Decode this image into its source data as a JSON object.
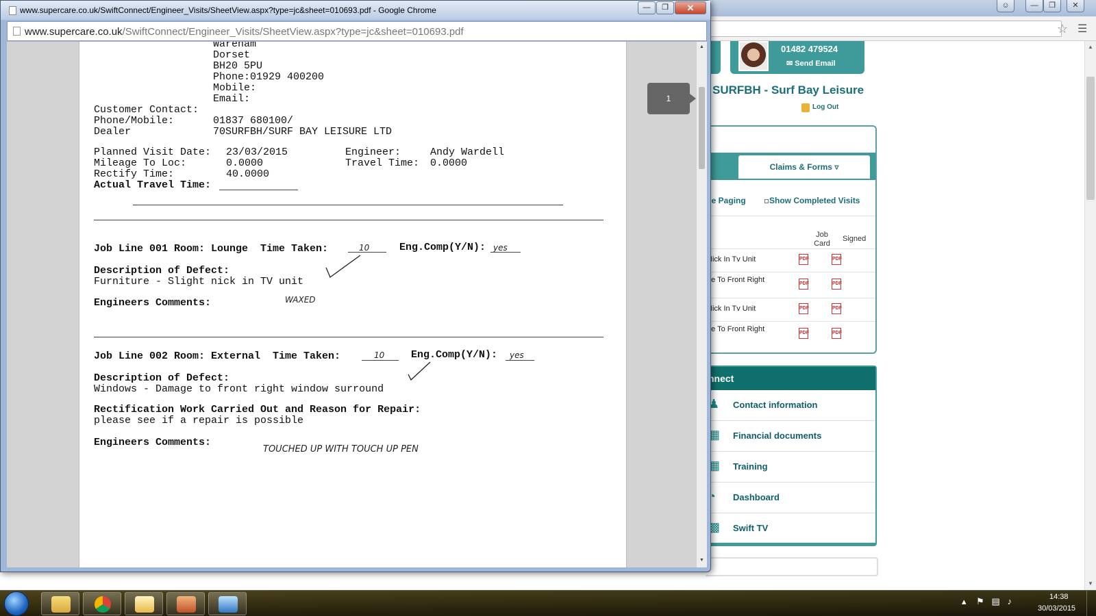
{
  "popup": {
    "title": "www.supercare.co.uk/SwiftConnect/Engineer_Visits/SheetView.aspx?type=jc&sheet=010693.pdf - Google Chrome",
    "url_host": "www.supercare.co.uk",
    "url_path": "/SwiftConnect/Engineer_Visits/SheetView.aspx?type=jc&sheet=010693.pdf",
    "page_badge": "1"
  },
  "pdf": {
    "address_lines": [
      "Wareham",
      "Dorset",
      "BH20 5PU",
      "Phone:01929 400200",
      "Mobile:",
      "Email:"
    ],
    "customer_contact_label": "Customer Contact:",
    "phone_mobile_label": "Phone/Mobile:",
    "phone_mobile_value": "01837 680100/",
    "dealer_label": "Dealer",
    "dealer_value": "70SURFBH/SURF BAY LEISURE LTD",
    "planned_visit_label": "Planned Visit Date:",
    "planned_visit_value": "23/03/2015",
    "engineer_label": "Engineer:",
    "engineer_value": "Andy Wardell",
    "mileage_label": "Mileage To Loc:",
    "mileage_value": "0.0000",
    "travel_time_label": "Travel Time:",
    "travel_time_value": "0.0000",
    "rectify_label": "Rectify Time:",
    "rectify_value": "40.0000",
    "actual_travel_label": "Actual Travel Time:",
    "job1": {
      "header": "Job Line 001 Room: Lounge  Time Taken:",
      "time_taken_hw": "10",
      "eng_comp_label": "Eng.Comp(Y/N):",
      "eng_comp_hw": "yes",
      "defect_label": "Description of Defect:",
      "defect_value": "Furniture - Slight nick in TV unit",
      "comments_label": "Engineers Comments:",
      "comments_hw": "WAXED"
    },
    "job2": {
      "header": "Job Line 002 Room: External  Time Taken:",
      "time_taken_hw": "10",
      "eng_comp_label": "Eng.Comp(Y/N):",
      "eng_comp_hw": "yes",
      "defect_label": "Description of Defect:",
      "defect_value": "Windows - Damage to front right window surround",
      "rectification_label": "Rectification Work Carried Out and Reason for Repair:",
      "rectification_value": "please see if a repair is possible",
      "comments_label": "Engineers Comments:",
      "comments_hw": "TOUCHED UP WITH TOUCH UP PEN"
    }
  },
  "site": {
    "phone": "01482 479524",
    "send_email": "Send Email",
    "company": "SURFBH - Surf Bay Leisure",
    "logout": "Log Out",
    "claims_tab": "Claims & Forms",
    "paging_link": "se Paging",
    "show_completed": "Show Completed Visits",
    "col_job_card": "Job Card",
    "col_signed": "Signed",
    "claim_rows": [
      "Nick In Tv Unit",
      "ge To Front Right",
      "Nick In Tv Unit",
      "ge To Front Right"
    ],
    "connect_heading": "nnect",
    "connect_items": [
      {
        "label": "Contact information",
        "icon": "people-icon"
      },
      {
        "label": "Financial documents",
        "icon": "calculator-icon"
      },
      {
        "label": "Training",
        "icon": "calendar-icon"
      },
      {
        "label": "Dashboard",
        "icon": "gauge-icon"
      },
      {
        "label": "Swift TV",
        "icon": "clapper-icon"
      }
    ]
  },
  "taskbar": {
    "time": "14:38",
    "date": "30/03/2015",
    "apps": [
      "file-explorer-icon",
      "chrome-icon",
      "outlook-icon",
      "contacts-icon",
      "remote-desktop-icon"
    ]
  },
  "colors": {
    "teal": "#3f9b99",
    "teal_dark": "#0e6f6c",
    "link": "#1a6e77"
  }
}
